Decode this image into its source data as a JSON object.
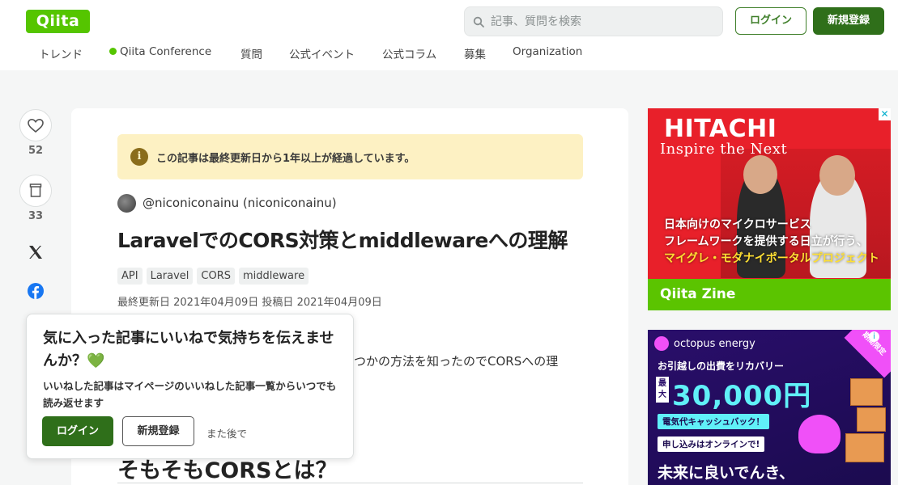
{
  "header": {
    "logo": "Qiita",
    "search_placeholder": "記事、質問を検索",
    "login_label": "ログイン",
    "signup_label": "新規登録",
    "nav": [
      {
        "label": "トレンド"
      },
      {
        "label": "Qiita Conference"
      },
      {
        "label": "質問"
      },
      {
        "label": "公式イベント"
      },
      {
        "label": "公式コラム"
      },
      {
        "label": "募集"
      },
      {
        "label": "Organization"
      }
    ]
  },
  "rail": {
    "likes_count": "52",
    "stocks_count": "33",
    "icons": [
      "heart-icon",
      "stock-icon",
      "x-icon",
      "facebook-icon"
    ]
  },
  "article": {
    "notice": "この記事は最終更新日から1年以上が経過しています。",
    "author": "@niconiconainu (niconiconainu)",
    "title": "LaravelでのCORS対策とmiddlewareへの理解",
    "tags": [
      "API",
      "Laravel",
      "CORS",
      "middleware"
    ],
    "dates": "最終更新日 2021年04月09日  投稿日 2021年04月09日",
    "body_snippet": "つかの方法を知ったのでCORSへの理",
    "heading": "そもそもCORSとは？"
  },
  "popup": {
    "heading": "気に入った記事にいいねで気持ちを伝えませんか？💚",
    "description": "いいねした記事はマイページのいいねした記事一覧からいつでも読み返せます",
    "login_label": "ログイン",
    "signup_label": "新規登録",
    "later_label": "また後で"
  },
  "ads": {
    "hitachi": {
      "brand": "HITACHI",
      "slogan": "Inspire the Next",
      "copy_line1": "日本向けのマイクロサービス",
      "copy_line2": "フレームワークを提供する日立が行う、",
      "copy_line3": "マイグレ・モダナイポータルプロジェクト",
      "footer": "Qiita Zine"
    },
    "octopus": {
      "brand": "octopus energy",
      "line1": "お引越しの出費をリカバリー",
      "max": "最大",
      "amount": "30,000円",
      "cashback": "電気代キャッシュバック！",
      "apply": "申し込みはオンラインで!",
      "future": "未来に良いでんき、",
      "corner": "期間限定"
    }
  },
  "colors": {
    "brand_green": "#55c500",
    "dark_green": "#2f6f1a",
    "notice_bg": "#fdf1c3"
  }
}
